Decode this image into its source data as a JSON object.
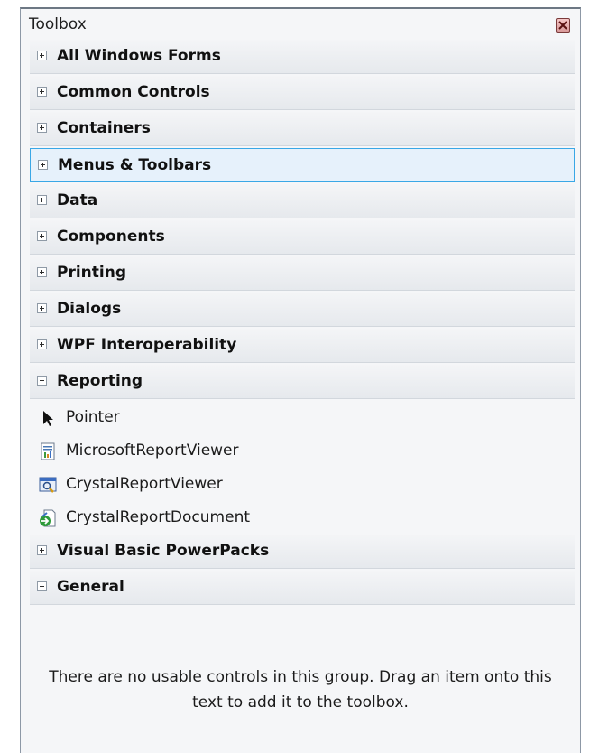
{
  "toolbox": {
    "title": "Toolbox"
  },
  "groups": {
    "all_windows_forms": "All Windows Forms",
    "common_controls": "Common Controls",
    "containers": "Containers",
    "menus_toolbars": "Menus & Toolbars",
    "data": "Data",
    "components": "Components",
    "printing": "Printing",
    "dialogs": "Dialogs",
    "wpf_interoperability": "WPF Interoperability",
    "reporting": "Reporting",
    "visual_basic_powerpacks": "Visual Basic PowerPacks",
    "general": "General"
  },
  "reporting_items": {
    "pointer": "Pointer",
    "microsoft_report_viewer": "MicrosoftReportViewer",
    "crystal_report_viewer": "CrystalReportViewer",
    "crystal_report_document": "CrystalReportDocument"
  },
  "general_empty_message": "There are no usable controls in this group. Drag an item onto this text to add it to the toolbox.",
  "icons": {
    "close": "close-icon",
    "expand": "plus-expander-icon",
    "collapse": "minus-expander-icon",
    "pointer": "pointer-arrow-icon",
    "report_viewer": "report-viewer-icon",
    "crystal_viewer": "crystal-report-viewer-icon",
    "crystal_document": "crystal-report-document-icon"
  },
  "colors": {
    "selection_border": "#39a7e6",
    "selection_fill": "#e6f1fb"
  }
}
